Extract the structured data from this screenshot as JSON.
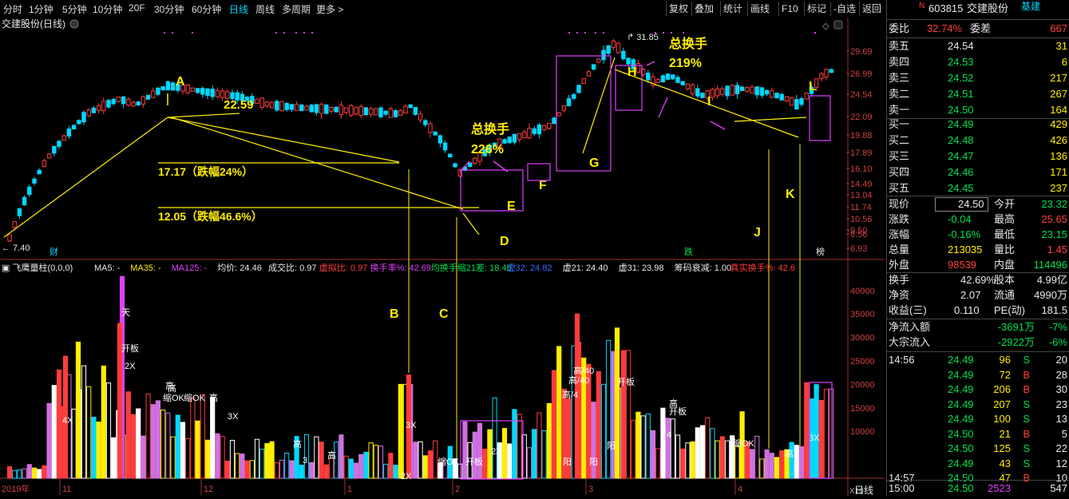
{
  "toolbar": {
    "periods": [
      "分时",
      "1分钟",
      "5分钟",
      "10分钟",
      "20F",
      "30分钟",
      "60分钟",
      "日线",
      "周线",
      "多周期",
      "更多 >"
    ],
    "active_period": "日线",
    "right": [
      "复权",
      "叠加",
      "统计",
      "画线",
      "F10",
      "标记",
      "-自选",
      "返回"
    ]
  },
  "chart": {
    "title": "交建股份(日线)",
    "price_axis": [
      "29.69",
      "26.99",
      "24.54",
      "22.09",
      "19.88",
      "17.89",
      "16.10",
      "14.49",
      "13.04",
      "11.74",
      "10.56",
      "9.50",
      "8.56",
      "6.93"
    ],
    "high_marker": "31.85",
    "low_marker": "7.40",
    "left_tag": "财",
    "mid_tag": "跌",
    "right_tag": "榜",
    "annotations": {
      "A": "A",
      "B": "B",
      "C": "C",
      "D": "D",
      "E": "E",
      "F": "F",
      "G": "G",
      "H": "H",
      "I": "I",
      "J": "J",
      "K": "K",
      "L": "L",
      "price_2259": "22.59",
      "drop1": "17.17（跌幅24%）",
      "drop2": "12.05（跌幅46.6%）",
      "turnover1_label": "总换手",
      "turnover1_value": "226%",
      "turnover2_label": "总换手",
      "turnover2_value": "219%"
    }
  },
  "indicator": {
    "name": "飞鹰量柱(0,0,0)",
    "items": [
      {
        "text": "MA5: -",
        "color": "#e8e8e8"
      },
      {
        "text": "MA35: -",
        "color": "#ffee00"
      },
      {
        "text": "MA125: -",
        "color": "#e040ff"
      },
      {
        "text": "均价: 24.46",
        "color": "#e8e8e8"
      },
      {
        "text": "成交比: 0.97",
        "color": "#e8e8e8"
      },
      {
        "text": "虚拟比: 0.97",
        "color": "#ff3c3c"
      },
      {
        "text": "换手率%: 42.69",
        "color": "#e040ff"
      },
      {
        "text": "均换手缩21差: 18.45",
        "color": "#00e050"
      },
      {
        "text": "虚32: 24.82",
        "color": "#3070ff"
      },
      {
        "text": "虚21: 24.40",
        "color": "#e8e8e8"
      },
      {
        "text": "虚31: 23.98",
        "color": "#e8e8e8"
      },
      {
        "text": "筹码衰减: 1.00",
        "color": "#e8e8e8"
      },
      {
        "text": "真实换手%: 42.6",
        "color": "#ff3c3c"
      }
    ],
    "vol_axis": [
      "40000",
      "35000",
      "30000",
      "25000",
      "20000",
      "15000",
      "10000"
    ],
    "vol_scale": "X10",
    "bar_labels": [
      "天",
      "开板",
      "2X",
      "高",
      "缩OK",
      "缩OK",
      "高",
      "4X",
      "高",
      "高/40",
      "高/40",
      "高/4",
      "开板",
      "高",
      "开板",
      "缩OK",
      "高",
      "3X",
      "2X",
      "3X",
      "高",
      "4",
      "3",
      "缩OK",
      "开板",
      "阳",
      "阳",
      "阳",
      "3X",
      "高",
      "2X"
    ]
  },
  "date_axis": {
    "labels": [
      "2019年",
      "11",
      "12",
      "1",
      "2",
      "3",
      "4"
    ],
    "period_label": "日线"
  },
  "quote": {
    "code": "603815",
    "name": "交建股份",
    "badge": "基建",
    "wb_label": "委比",
    "wb_value": "32.74%",
    "wc_label": "委差",
    "wc_value": "667",
    "sells": [
      {
        "label": "卖五",
        "price": "24.54",
        "vol": "31"
      },
      {
        "label": "卖四",
        "price": "24.53",
        "vol": "6"
      },
      {
        "label": "卖三",
        "price": "24.52",
        "vol": "217"
      },
      {
        "label": "卖二",
        "price": "24.51",
        "vol": "267"
      },
      {
        "label": "卖一",
        "price": "24.50",
        "vol": "164"
      }
    ],
    "buys": [
      {
        "label": "买一",
        "price": "24.49",
        "vol": "429"
      },
      {
        "label": "买二",
        "price": "24.48",
        "vol": "426"
      },
      {
        "label": "买三",
        "price": "24.47",
        "vol": "136"
      },
      {
        "label": "买四",
        "price": "24.46",
        "vol": "171"
      },
      {
        "label": "买五",
        "price": "24.45",
        "vol": "237"
      }
    ],
    "stats": [
      {
        "l1": "现价",
        "v1": "24.50",
        "c1": "white",
        "l2": "今开",
        "v2": "23.32",
        "c2": "green"
      },
      {
        "l1": "涨跌",
        "v1": "-0.04",
        "c1": "green",
        "l2": "最高",
        "v2": "25.65",
        "c2": "red"
      },
      {
        "l1": "涨幅",
        "v1": "-0.16%",
        "c1": "green",
        "l2": "最低",
        "v2": "23.15",
        "c2": "green"
      },
      {
        "l1": "总量",
        "v1": "213035",
        "c1": "yellow",
        "l2": "量比",
        "v2": "1.45",
        "c2": "red"
      },
      {
        "l1": "外盘",
        "v1": "98539",
        "c1": "red",
        "l2": "内盘",
        "v2": "114496",
        "c2": "green"
      }
    ],
    "stats2": [
      {
        "l1": "换手",
        "v1": "42.69%",
        "l2": "股本",
        "v2": "4.99亿"
      },
      {
        "l1": "净资",
        "v1": "2.07",
        "l2": "流通",
        "v2": "4990万"
      },
      {
        "l1": "收益(三)",
        "v1": "0.110",
        "l2": "PE(动)",
        "v2": "181.5"
      }
    ],
    "flows": [
      {
        "label": "净流入额",
        "value": "-3691万",
        "pct": "-7%"
      },
      {
        "label": "大宗流入",
        "value": "-2922万",
        "pct": "-6%"
      }
    ],
    "ticks": [
      {
        "time": "14:56",
        "price": "24.49",
        "vol": "96",
        "side": "S",
        "n": "20"
      },
      {
        "time": "",
        "price": "24.49",
        "vol": "72",
        "side": "B",
        "n": "28"
      },
      {
        "time": "",
        "price": "24.49",
        "vol": "206",
        "side": "B",
        "n": "30"
      },
      {
        "time": "",
        "price": "24.49",
        "vol": "207",
        "side": "S",
        "n": "23"
      },
      {
        "time": "",
        "price": "24.49",
        "vol": "100",
        "side": "S",
        "n": "13"
      },
      {
        "time": "",
        "price": "24.50",
        "vol": "21",
        "side": "B",
        "n": "5"
      },
      {
        "time": "",
        "price": "24.50",
        "vol": "125",
        "side": "S",
        "n": "22"
      },
      {
        "time": "",
        "price": "24.49",
        "vol": "43",
        "side": "S",
        "n": "12"
      },
      {
        "time": "14:57",
        "price": "24.50",
        "vol": "47",
        "side": "B",
        "n": "10"
      },
      {
        "time": "15:00",
        "price": "24.50",
        "vol": "2523",
        "side": "",
        "n": "547"
      }
    ]
  }
}
